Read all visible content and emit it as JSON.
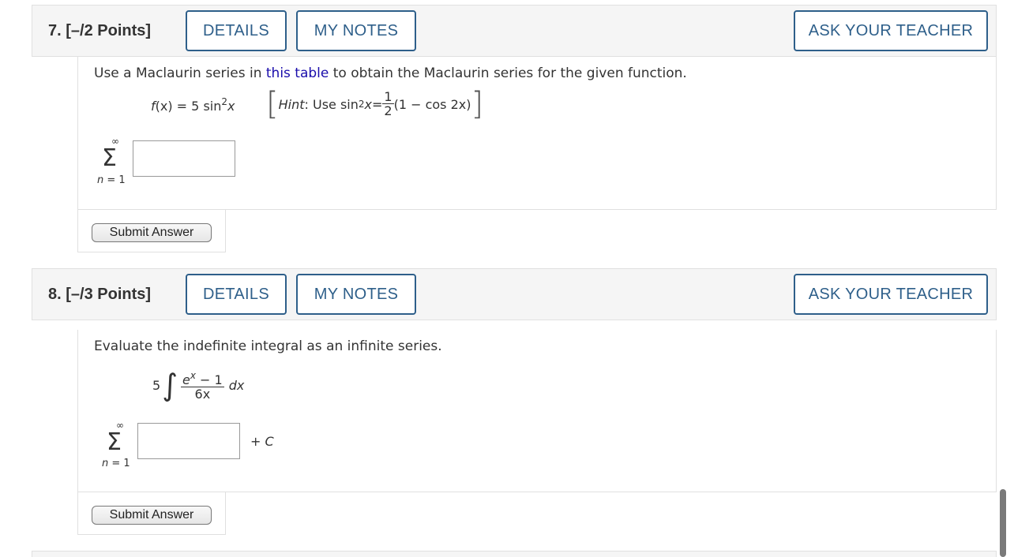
{
  "q7": {
    "number": "7.",
    "points": "[–/2 Points]",
    "details_label": "DETAILS",
    "notes_label": "MY NOTES",
    "ask_label": "ASK YOUR TEACHER",
    "prompt_before": "Use a Maclaurin series in ",
    "prompt_link": "this table",
    "prompt_after": " to obtain the Maclaurin series for the given function.",
    "func_lhs": "f",
    "func_paren": "(x) = 5 sin",
    "func_exp": "2",
    "func_var": "x",
    "hint_label": "Hint",
    "hint_use": ": Use sin",
    "hint_exp": "2",
    "hint_var": "x",
    "hint_eq": " = ",
    "hint_num": "1",
    "hint_den": "2",
    "hint_rest": "(1 − cos 2x)",
    "sum_upper": "∞",
    "sum_symbol": "Σ",
    "sum_lower": "n = 1",
    "answer_value": "",
    "submit_label": "Submit Answer"
  },
  "q8": {
    "number": "8.",
    "points": "[–/3 Points]",
    "details_label": "DETAILS",
    "notes_label": "MY NOTES",
    "ask_label": "ASK YOUR TEACHER",
    "prompt": "Evaluate the indefinite integral as an infinite series.",
    "coef": "5",
    "integral_symbol": "∫",
    "num_base": "e",
    "num_exp": "x",
    "num_rest": " − 1",
    "den": "6x",
    "dx": "dx",
    "sum_upper": "∞",
    "sum_symbol": "Σ",
    "sum_lower": "n = 1",
    "plus_c": "+ C",
    "answer_value": "",
    "submit_label": "Submit Answer"
  }
}
